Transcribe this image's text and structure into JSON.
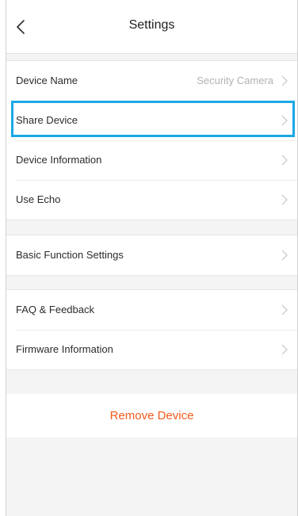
{
  "header": {
    "title": "Settings",
    "back_icon": "chevron-left-icon"
  },
  "group1": {
    "items": [
      {
        "label": "Device Name",
        "value": "Security Camera"
      },
      {
        "label": "Share Device",
        "value": ""
      },
      {
        "label": "Device Information",
        "value": ""
      },
      {
        "label": "Use Echo",
        "value": ""
      }
    ]
  },
  "group2": {
    "items": [
      {
        "label": "Basic Function Settings",
        "value": ""
      }
    ]
  },
  "group3": {
    "items": [
      {
        "label": "FAQ & Feedback",
        "value": ""
      },
      {
        "label": "Firmware Information",
        "value": ""
      }
    ]
  },
  "remove": {
    "label": "Remove Device"
  },
  "colors": {
    "accent_remove": "#f25a1c",
    "highlight_border": "#1aa8e6",
    "background": "#f4f4f4"
  }
}
